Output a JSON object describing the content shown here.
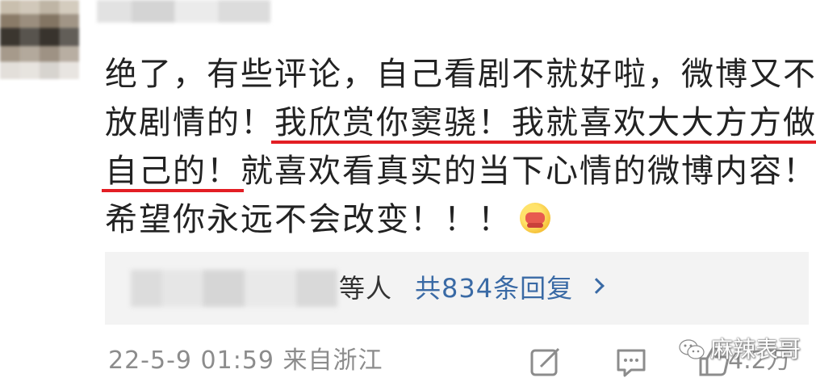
{
  "comment": {
    "line1": "绝了，有些评论，自己看剧不就好啦，微博又不是",
    "line2_plain": "放剧情的！",
    "line2_underlined": "我欣赏你窦骁！我就喜欢大大方方做",
    "line3_underlined": "自己的！",
    "line3_plain": "就喜欢看真实的当下心情的微博内容！",
    "line4": "希望你永远不会改变！！！",
    "emoji_icon": "hugging-face-emoji"
  },
  "replies": {
    "suffix": "等人",
    "count_label": "共834条回复"
  },
  "meta": {
    "timestamp": "22-5-9 01:59",
    "location": "来自浙江"
  },
  "actions": {
    "like_count": "4.2万"
  },
  "watermark": {
    "text": "麻辣表哥"
  },
  "colors": {
    "underline": "#e31e24",
    "link": "#3a6aa5",
    "meta": "#8c8c8c",
    "reply_bg": "#f3f3f3"
  }
}
